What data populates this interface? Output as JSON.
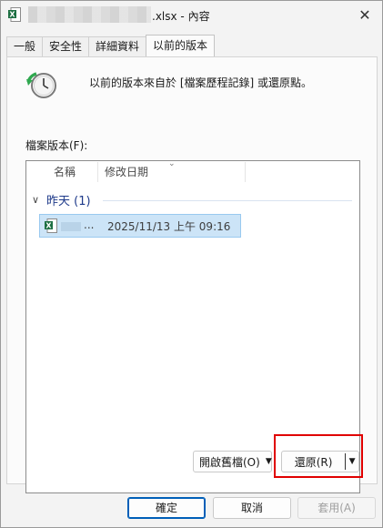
{
  "window": {
    "title_suffix": ".xlsx - 內容",
    "close_glyph": "✕"
  },
  "tabs": [
    {
      "label": "一般",
      "active": false
    },
    {
      "label": "安全性",
      "active": false
    },
    {
      "label": "詳細資料",
      "active": false
    },
    {
      "label": "以前的版本",
      "active": true
    }
  ],
  "panel": {
    "description": "以前的版本來自於 [檔案歷程記錄] 或還原點。",
    "file_versions_label": "檔案版本(F):",
    "columns": [
      "名稱",
      "修改日期"
    ],
    "group": {
      "label": "昨天 (1)",
      "chevron": "∨"
    },
    "rows": [
      {
        "name_visible": "...",
        "modified": "2025/11/13 上午 09:16",
        "selected": true
      }
    ],
    "open_button": "開啟舊檔(O)",
    "restore_button": "還原(R)"
  },
  "footer": {
    "ok": "確定",
    "cancel": "取消",
    "apply": "套用(A)"
  },
  "colors": {
    "accent": "#005fb8",
    "selection_bg": "#cce4f7",
    "highlight": "#e00000",
    "excel_green": "#1d6f42"
  }
}
